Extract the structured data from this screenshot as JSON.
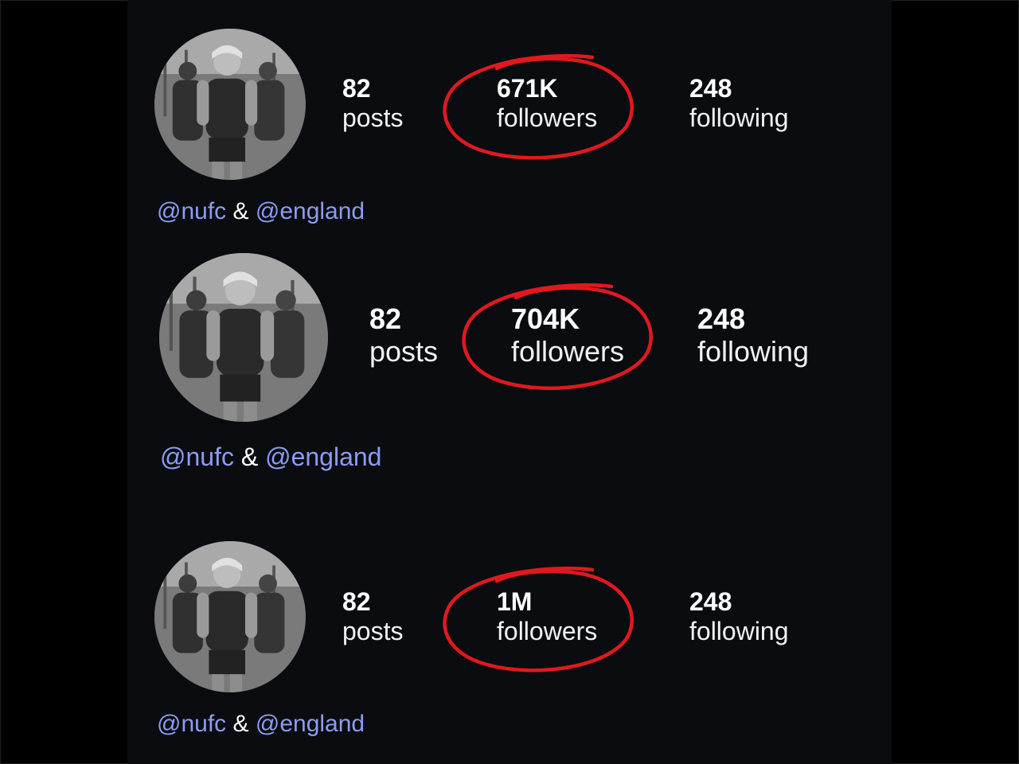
{
  "accent_color": "#e0191e",
  "mention_color": "#8c9cf2",
  "profiles": [
    {
      "posts": {
        "value": "82",
        "label": "posts"
      },
      "followers": {
        "value": "671K",
        "label": "followers"
      },
      "following": {
        "value": "248",
        "label": "following"
      },
      "bio": {
        "mention1": "@nufc",
        "amp": "&",
        "mention2": "@england"
      }
    },
    {
      "posts": {
        "value": "82",
        "label": "posts"
      },
      "followers": {
        "value": "704K",
        "label": "followers"
      },
      "following": {
        "value": "248",
        "label": "following"
      },
      "bio": {
        "mention1": "@nufc",
        "amp": "&",
        "mention2": "@england"
      }
    },
    {
      "posts": {
        "value": "82",
        "label": "posts"
      },
      "followers": {
        "value": "1M",
        "label": "followers"
      },
      "following": {
        "value": "248",
        "label": "following"
      },
      "bio": {
        "mention1": "@nufc",
        "amp": "&",
        "mention2": "@england"
      }
    }
  ]
}
